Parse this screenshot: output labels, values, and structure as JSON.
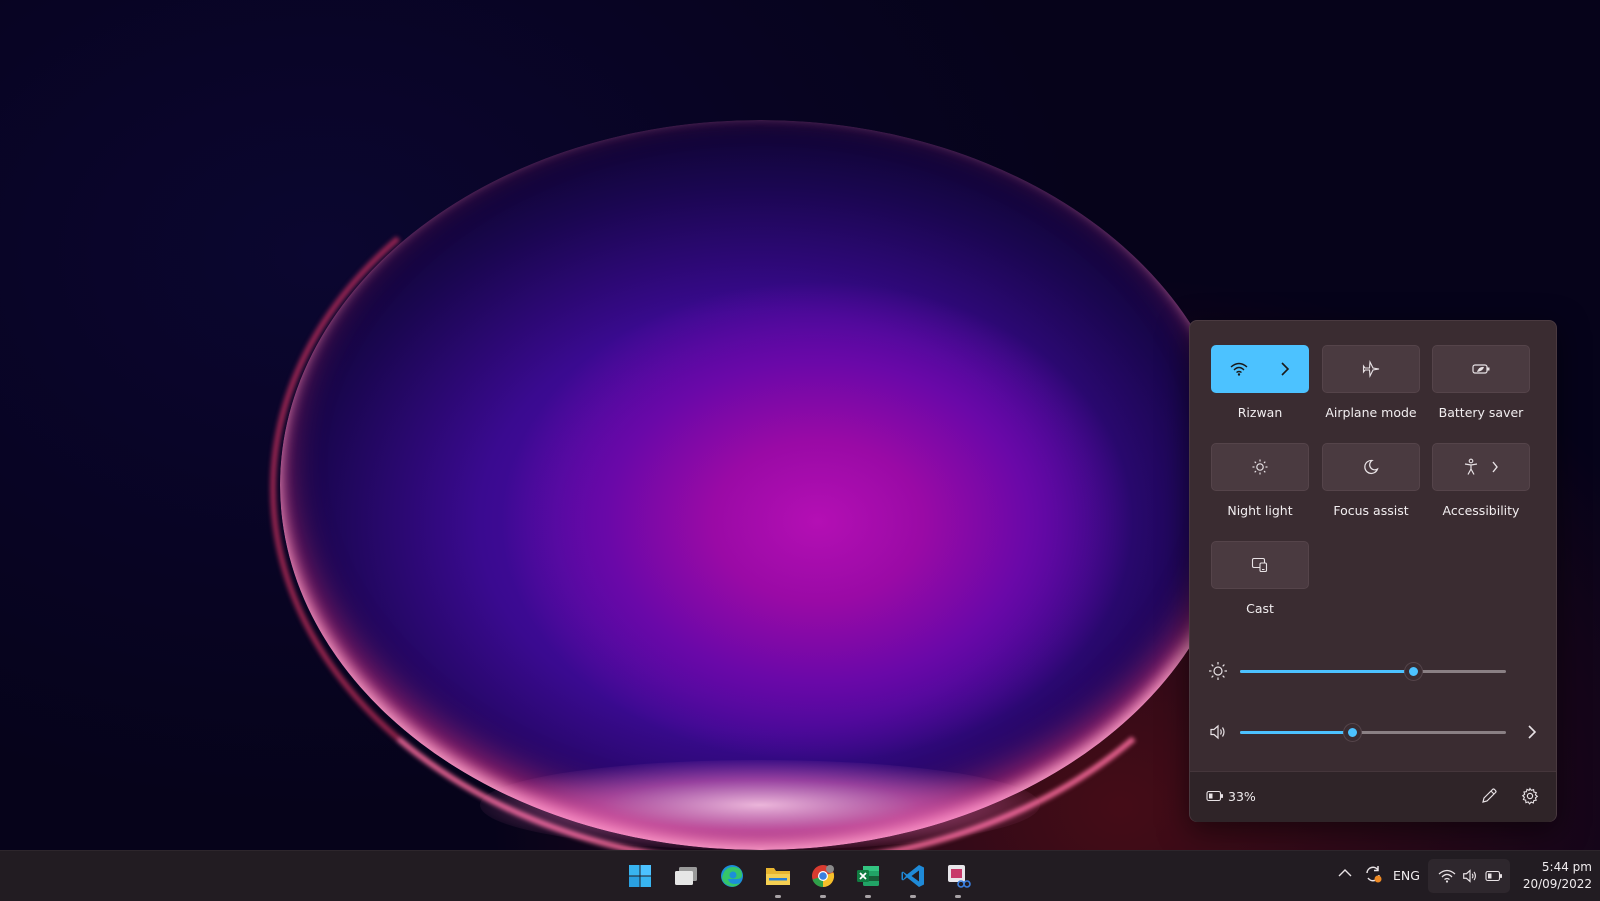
{
  "quick_settings": {
    "tiles": [
      {
        "label": "Rizwan",
        "icon": "wifi-icon",
        "active": true
      },
      {
        "label": "Airplane mode",
        "icon": "airplane-icon",
        "active": false
      },
      {
        "label": "Battery saver",
        "icon": "battery-saver-icon",
        "active": false
      },
      {
        "label": "Night light",
        "icon": "night-light-icon",
        "active": false
      },
      {
        "label": "Focus assist",
        "icon": "moon-icon",
        "active": false
      },
      {
        "label": "Accessibility",
        "icon": "accessibility-icon",
        "active": false
      },
      {
        "label": "Cast",
        "icon": "cast-icon",
        "active": false
      }
    ],
    "brightness": {
      "icon": "sun-icon",
      "value": 0.65
    },
    "volume": {
      "icon": "speaker-icon",
      "value": 0.42
    },
    "battery": {
      "icon": "battery-icon",
      "percent": "33%"
    },
    "footer_icons": [
      "pencil-icon",
      "gear-icon"
    ]
  },
  "taskbar": {
    "apps": [
      "start-icon",
      "task-view-icon",
      "edge-icon",
      "file-explorer-icon",
      "chrome-icon",
      "excel-icon",
      "vscode-icon",
      "snipping-tool-icon"
    ],
    "tray": {
      "language": "ENG",
      "time": "5:44 pm",
      "date": "20/09/2022"
    }
  },
  "colors": {
    "accent": "#4cc2ff",
    "panel": "#3a2c31",
    "taskbar": "#221c22"
  }
}
